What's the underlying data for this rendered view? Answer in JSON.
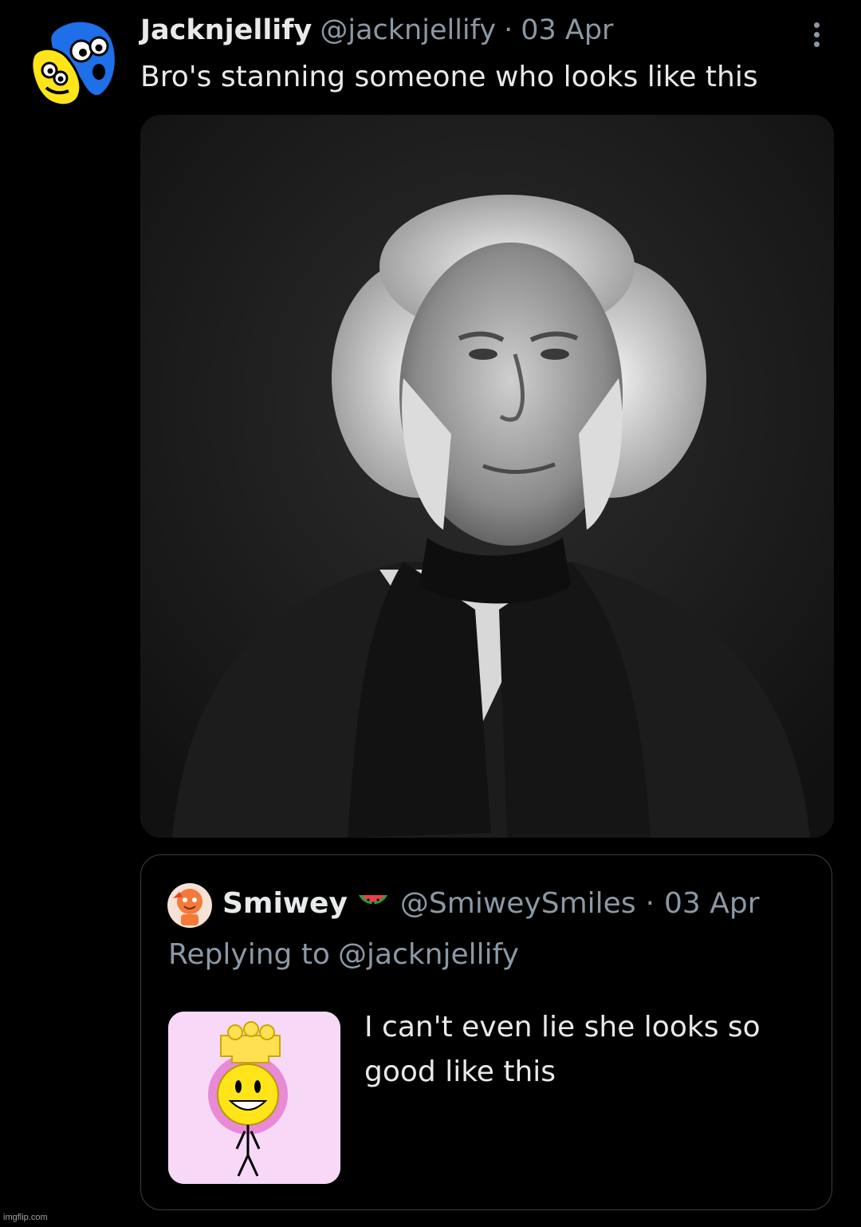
{
  "tweet": {
    "avatar_icon": "cartoon-character-avatar-icon",
    "display_name": "Jacknjellify",
    "handle": "@jacknjellify",
    "separator": "·",
    "date": "03 Apr",
    "more_icon": "vertical-ellipsis-icon",
    "text": "Bro's stanning someone who looks like this",
    "media_description_icon": "portrait-photo"
  },
  "quote": {
    "avatar_icon": "orange-character-avatar-icon",
    "display_name": "Smiwey",
    "name_emoji": "watermelon-emoji-icon",
    "handle": "@SmiweySmiles",
    "separator": "·",
    "date": "03 Apr",
    "reply_prefix": "Replying to",
    "reply_handle": "@jacknjellify",
    "text": "I can't even lie she looks so good like this",
    "thumb_icon": "yellow-sun-character-icon"
  },
  "watermark": "imgflip.com",
  "colors": {
    "background": "#000000",
    "text_primary": "#e7e9ea",
    "text_secondary": "#8b98a5",
    "border": "#3a3f44"
  }
}
